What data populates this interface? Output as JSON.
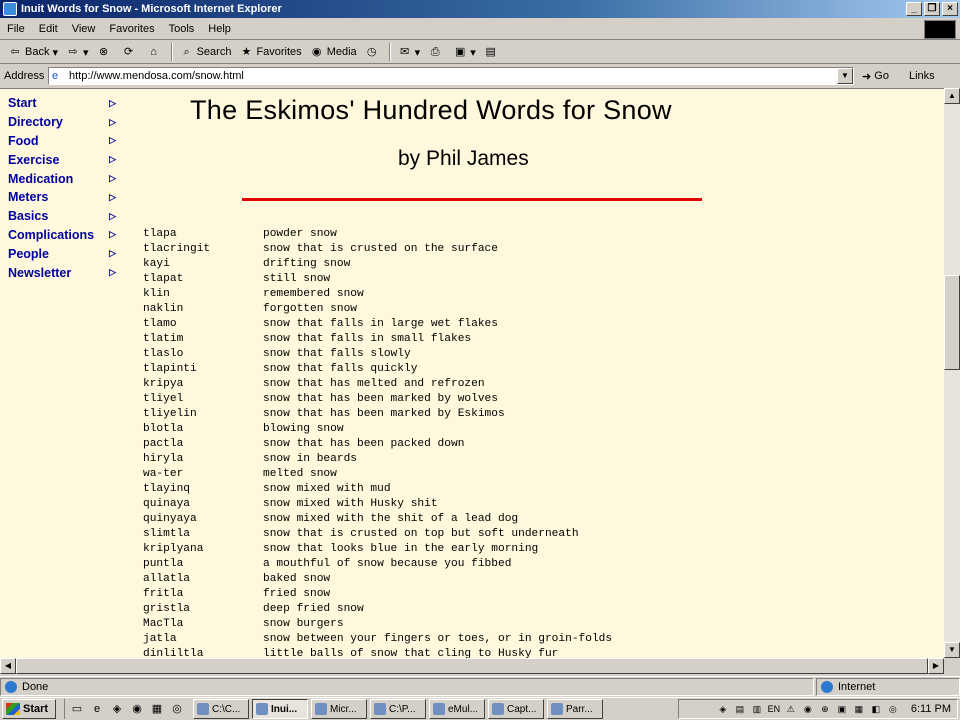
{
  "window": {
    "title": "Inuit Words for Snow - Microsoft Internet Explorer"
  },
  "menu": [
    "File",
    "Edit",
    "View",
    "Favorites",
    "Tools",
    "Help"
  ],
  "toolbar": {
    "back": "Back",
    "search": "Search",
    "favorites": "Favorites",
    "media": "Media"
  },
  "address": {
    "label": "Address",
    "url": "http://www.mendosa.com/snow.html",
    "go": "Go",
    "links": "Links"
  },
  "nav": [
    "Start",
    "Directory",
    "Food",
    "Exercise",
    "Medication",
    "Meters",
    "Basics",
    "Complications",
    "People",
    "Newsletter"
  ],
  "page": {
    "title": "The Eskimos' Hundred Words for Snow",
    "byline": "by Phil James"
  },
  "words": [
    [
      "tlapa",
      "powder snow"
    ],
    [
      "tlacringit",
      "snow that is crusted on the surface"
    ],
    [
      "kayi",
      "drifting snow"
    ],
    [
      "tlapat",
      "still snow"
    ],
    [
      "klin",
      "remembered snow"
    ],
    [
      "naklin",
      "forgotten snow"
    ],
    [
      "tlamo",
      "snow that falls in large wet flakes"
    ],
    [
      "tlatim",
      "snow that falls in small flakes"
    ],
    [
      "tlaslo",
      "snow that falls slowly"
    ],
    [
      "tlapinti",
      "snow that falls quickly"
    ],
    [
      "kripya",
      "snow that has melted and refrozen"
    ],
    [
      "tliyel",
      "snow that has been marked by wolves"
    ],
    [
      "tliyelin",
      "snow that has been marked by Eskimos"
    ],
    [
      "blotla",
      "blowing snow"
    ],
    [
      "pactla",
      "snow that has been packed down"
    ],
    [
      "hiryla",
      "snow in beards"
    ],
    [
      "wa-ter",
      "melted snow"
    ],
    [
      "tlayinq",
      "snow mixed with mud"
    ],
    [
      "quinaya",
      "snow mixed with Husky shit"
    ],
    [
      "quinyaya",
      "snow mixed with the shit of a lead dog"
    ],
    [
      "slimtla",
      "snow that is crusted on top but soft underneath"
    ],
    [
      "kriplyana",
      "snow that looks blue in the early morning"
    ],
    [
      "puntla",
      "a mouthful of snow because you fibbed"
    ],
    [
      "allatla",
      "baked snow"
    ],
    [
      "fritla",
      "fried snow"
    ],
    [
      "gristla",
      "deep fried snow"
    ],
    [
      "MacTla",
      "snow burgers"
    ],
    [
      "jatla",
      "snow between your fingers or toes, or in groin-folds"
    ],
    [
      "dinliltla",
      "little balls of snow that cling to Husky fur"
    ]
  ],
  "status": {
    "text": "Done",
    "zone": "Internet"
  },
  "taskbar": {
    "start": "Start",
    "tasks": [
      "C:\\C...",
      "Inui...",
      "Micr...",
      "C:\\P...",
      "eMul...",
      "Capt...",
      "Parr..."
    ],
    "clock": "6:11 PM",
    "tray_lang": "EN"
  },
  "colors": {
    "page_bg": "#fff8dc",
    "nav_text": "#0000a0",
    "rule": "#e00000",
    "title_bar": "#0a246a"
  }
}
